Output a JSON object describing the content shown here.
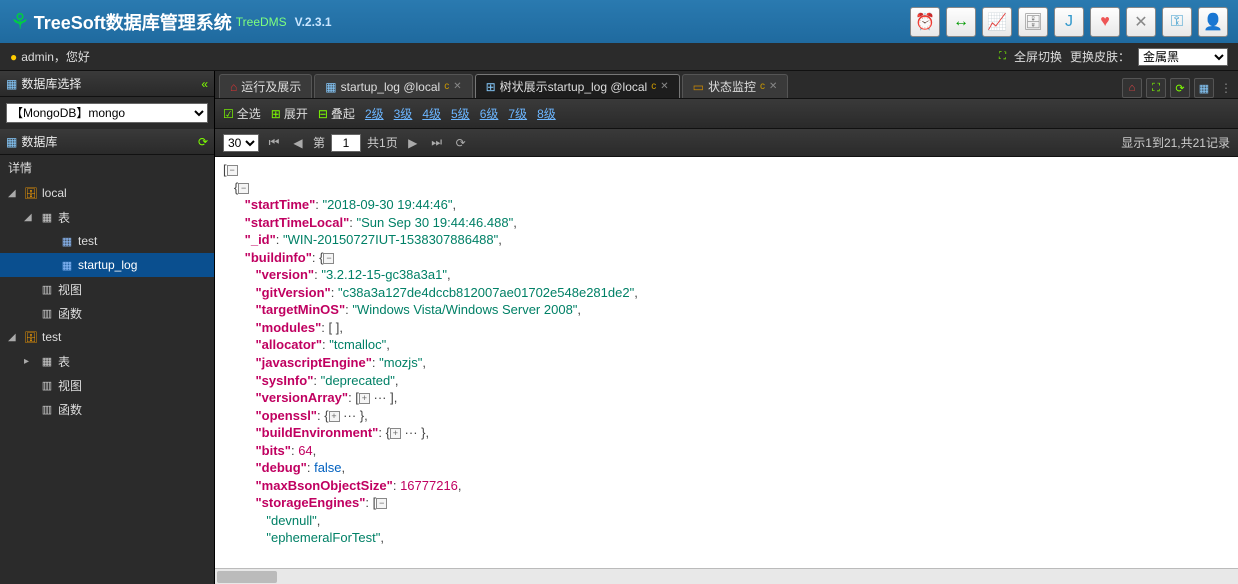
{
  "app": {
    "title": "TreeSoft数据库管理系统",
    "subtitle": "TreeDMS",
    "version": "V.2.3.1"
  },
  "subbar": {
    "user_icon": "●",
    "greeting": "admin，您好",
    "fullscreen": "全屏切换",
    "skin_label": "更换皮肤：",
    "skin_value": "金属黑"
  },
  "sidebar": {
    "select_title": "数据库选择",
    "db_selected": "【MongoDB】mongo",
    "db_title": "数据库",
    "detail": "详情",
    "nodes": {
      "local": "local",
      "tables": "表",
      "test": "test",
      "startup_log": "startup_log",
      "views": "视图",
      "funcs": "函数",
      "test_db": "test",
      "t_tables": "表",
      "t_views": "视图",
      "t_funcs": "函数"
    }
  },
  "tabs": {
    "t1": "运行及展示",
    "t2": "startup_log @local",
    "t3": "树状展示startup_log @local",
    "t4": "状态监控"
  },
  "toolbar": {
    "select_all": "全选",
    "expand": "展开",
    "collapse": "叠起",
    "levels": [
      "2级",
      "3级",
      "4级",
      "5级",
      "6级",
      "7级",
      "8级"
    ]
  },
  "pager": {
    "page_size": "30",
    "page_label_pre": "第",
    "page_val": "1",
    "page_label_post": "共1页",
    "summary": "显示1到21,共21记录"
  },
  "chart_data": {
    "type": "table",
    "record": {
      "startTime": "2018-09-30 19:44:46",
      "startTimeLocal": "Sun Sep 30 19:44:46.488",
      "_id": "WIN-20150727IUT-1538307886488",
      "buildinfo": {
        "version": "3.2.12-15-gc38a3a1",
        "gitVersion": "c38a3a127de4dccb812007ae01702e548e281de2",
        "targetMinOS": "Windows Vista/Windows Server 2008",
        "modules": [],
        "allocator": "tcmalloc",
        "javascriptEngine": "mozjs",
        "sysInfo": "deprecated",
        "versionArray": "[⊞ ···]",
        "openssl": "{⊞ ···}",
        "buildEnvironment": "{⊞ ···}",
        "bits": 64,
        "debug": false,
        "maxBsonObjectSize": 16777216,
        "storageEngines": [
          "devnull",
          "ephemeralForTest"
        ]
      }
    }
  }
}
